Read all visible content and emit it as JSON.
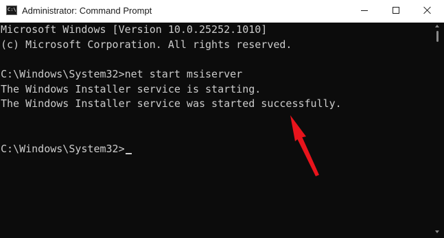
{
  "window": {
    "title": "Administrator: Command Prompt",
    "app_icon_text": "C:\\."
  },
  "console": {
    "lines": [
      "Microsoft Windows [Version 10.0.25252.1010]",
      "(c) Microsoft Corporation. All rights reserved.",
      "",
      "C:\\Windows\\System32>net start msiserver",
      "The Windows Installer service is starting.",
      "The Windows Installer service was started successfully.",
      "",
      "",
      "C:\\Windows\\System32>"
    ]
  },
  "colors": {
    "console_background": "#0c0c0c",
    "console_text": "#cccccc",
    "titlebar_background": "#ffffff",
    "annotation_arrow": "#e8141c"
  },
  "icons": {
    "app": "command-prompt-icon",
    "minimize": "minimize-icon",
    "maximize": "maximize-icon",
    "close": "close-icon",
    "annotation": "red-arrow-icon"
  }
}
